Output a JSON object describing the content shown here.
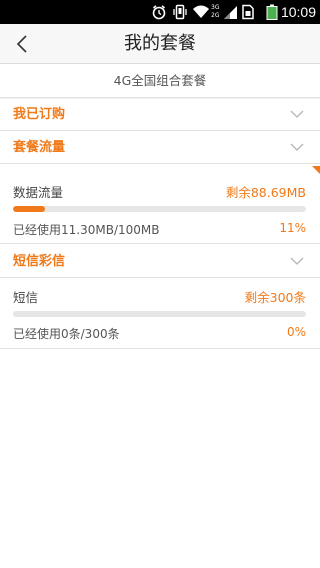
{
  "status_bar": {
    "time": "10:09",
    "network_label_top": "3G",
    "network_label_bottom": "2G",
    "icons": [
      "alarm-icon",
      "vibrate-icon",
      "wifi-icon",
      "signal-icon",
      "sim-icon",
      "battery-icon"
    ]
  },
  "header": {
    "title": "我的套餐",
    "back_icon": "chevron-left-icon"
  },
  "plan": {
    "name": "4G全国组合套餐"
  },
  "sections": {
    "subscribed": {
      "title": "我已订购"
    },
    "package_data": {
      "title": "套餐流量"
    },
    "sms_mms": {
      "title": "短信彩信"
    }
  },
  "data_usage": {
    "label": "数据流量",
    "remaining": "剩余88.69MB",
    "used": "已经使用11.30MB/100MB",
    "percent": "11%",
    "fraction": 0.11
  },
  "sms_usage": {
    "label": "短信",
    "remaining": "剩余300条",
    "used": "已经使用0条/300条",
    "percent": "0%",
    "fraction": 0
  },
  "colors": {
    "accent": "#f07a1a",
    "header_bg": "#f7f7f7",
    "divider": "#e2e2e2"
  }
}
